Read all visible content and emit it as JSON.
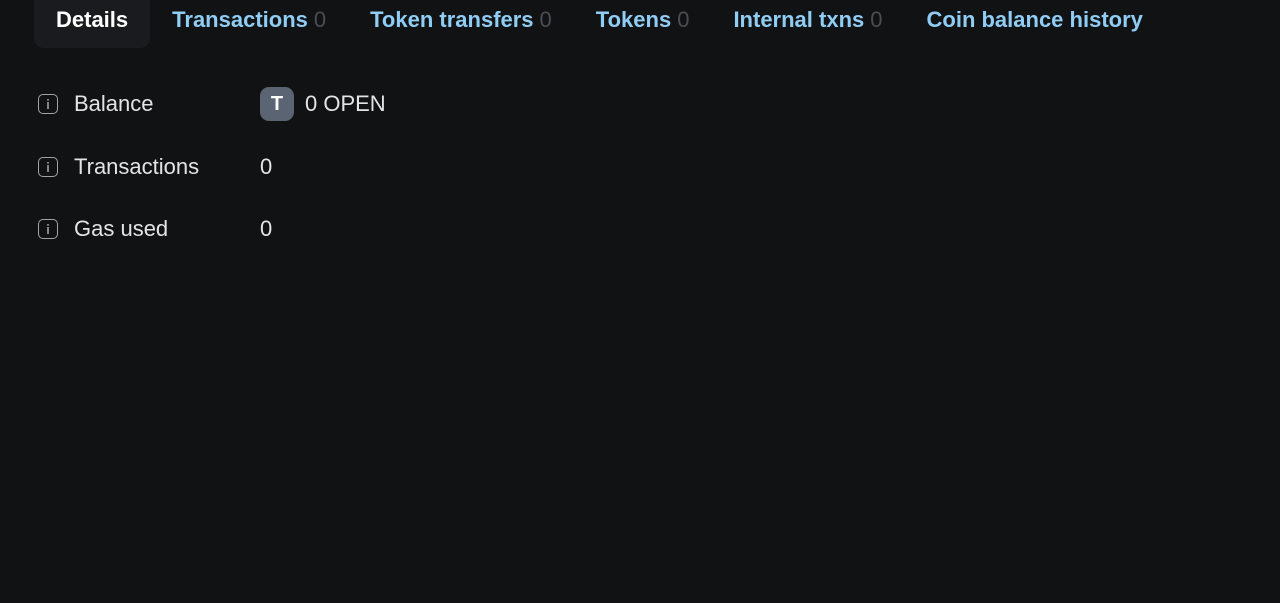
{
  "tabs": [
    {
      "label": "Details",
      "count": ""
    },
    {
      "label": "Transactions",
      "count": "0"
    },
    {
      "label": "Token transfers",
      "count": "0"
    },
    {
      "label": "Tokens",
      "count": "0"
    },
    {
      "label": "Internal txns",
      "count": "0"
    },
    {
      "label": "Coin balance history",
      "count": ""
    }
  ],
  "active_tab": "Details",
  "details": {
    "balance": {
      "label": "Balance",
      "token_letter": "T",
      "value": "0 OPEN"
    },
    "transactions": {
      "label": "Transactions",
      "value": "0"
    },
    "gas_used": {
      "label": "Gas used",
      "value": "0"
    }
  },
  "colors": {
    "background": "#111214",
    "tab_link": "#90cdf4",
    "tab_count": "#4a4d53",
    "active_tab_bg": "#1a1b1e",
    "token_badge": "#5b6472"
  },
  "icons": {
    "info": "info-icon"
  }
}
